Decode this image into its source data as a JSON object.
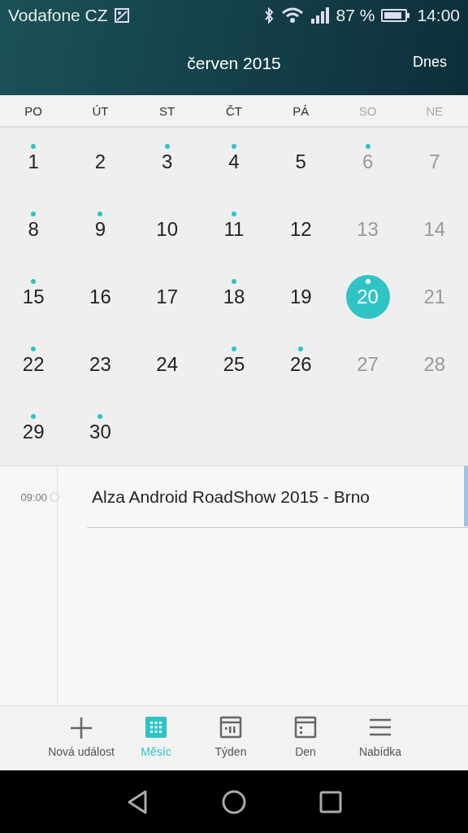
{
  "status_bar": {
    "carrier": "Vodafone CZ",
    "battery_text": "87 %",
    "time": "14:00"
  },
  "header": {
    "title": "červen 2015",
    "today_button": "Dnes"
  },
  "weekdays": [
    {
      "label": "PO",
      "weekend": false
    },
    {
      "label": "ÚT",
      "weekend": false
    },
    {
      "label": "ST",
      "weekend": false
    },
    {
      "label": "ČT",
      "weekend": false
    },
    {
      "label": "PÁ",
      "weekend": false
    },
    {
      "label": "SO",
      "weekend": true
    },
    {
      "label": "NE",
      "weekend": true
    }
  ],
  "weeks": [
    [
      {
        "day": "1",
        "event": true,
        "weekend": false,
        "selected": false
      },
      {
        "day": "2",
        "event": false,
        "weekend": false,
        "selected": false
      },
      {
        "day": "3",
        "event": true,
        "weekend": false,
        "selected": false
      },
      {
        "day": "4",
        "event": true,
        "weekend": false,
        "selected": false
      },
      {
        "day": "5",
        "event": false,
        "weekend": false,
        "selected": false
      },
      {
        "day": "6",
        "event": true,
        "weekend": true,
        "selected": false
      },
      {
        "day": "7",
        "event": false,
        "weekend": true,
        "selected": false
      }
    ],
    [
      {
        "day": "8",
        "event": true,
        "weekend": false,
        "selected": false
      },
      {
        "day": "9",
        "event": true,
        "weekend": false,
        "selected": false
      },
      {
        "day": "10",
        "event": false,
        "weekend": false,
        "selected": false
      },
      {
        "day": "11",
        "event": true,
        "weekend": false,
        "selected": false
      },
      {
        "day": "12",
        "event": false,
        "weekend": false,
        "selected": false
      },
      {
        "day": "13",
        "event": false,
        "weekend": true,
        "selected": false
      },
      {
        "day": "14",
        "event": false,
        "weekend": true,
        "selected": false
      }
    ],
    [
      {
        "day": "15",
        "event": true,
        "weekend": false,
        "selected": false
      },
      {
        "day": "16",
        "event": false,
        "weekend": false,
        "selected": false
      },
      {
        "day": "17",
        "event": false,
        "weekend": false,
        "selected": false
      },
      {
        "day": "18",
        "event": true,
        "weekend": false,
        "selected": false
      },
      {
        "day": "19",
        "event": false,
        "weekend": false,
        "selected": false
      },
      {
        "day": "20",
        "event": true,
        "weekend": true,
        "selected": true
      },
      {
        "day": "21",
        "event": false,
        "weekend": true,
        "selected": false
      }
    ],
    [
      {
        "day": "22",
        "event": true,
        "weekend": false,
        "selected": false
      },
      {
        "day": "23",
        "event": false,
        "weekend": false,
        "selected": false
      },
      {
        "day": "24",
        "event": false,
        "weekend": false,
        "selected": false
      },
      {
        "day": "25",
        "event": true,
        "weekend": false,
        "selected": false
      },
      {
        "day": "26",
        "event": true,
        "weekend": false,
        "selected": false
      },
      {
        "day": "27",
        "event": false,
        "weekend": true,
        "selected": false
      },
      {
        "day": "28",
        "event": false,
        "weekend": true,
        "selected": false
      }
    ],
    [
      {
        "day": "29",
        "event": true,
        "weekend": false,
        "selected": false
      },
      {
        "day": "30",
        "event": true,
        "weekend": false,
        "selected": false
      }
    ]
  ],
  "events": [
    {
      "time": "09:00",
      "title": "Alza Android RoadShow 2015 - Brno",
      "color": "#9ec3e6"
    }
  ],
  "bottom_nav": [
    {
      "kind": "add",
      "label": "Nová událost",
      "selected": false
    },
    {
      "kind": "month",
      "label": "Měsíc",
      "selected": true
    },
    {
      "kind": "week",
      "label": "Týden",
      "selected": false
    },
    {
      "kind": "day",
      "label": "Den",
      "selected": false
    },
    {
      "kind": "menu",
      "label": "Nabídka",
      "selected": false
    }
  ]
}
